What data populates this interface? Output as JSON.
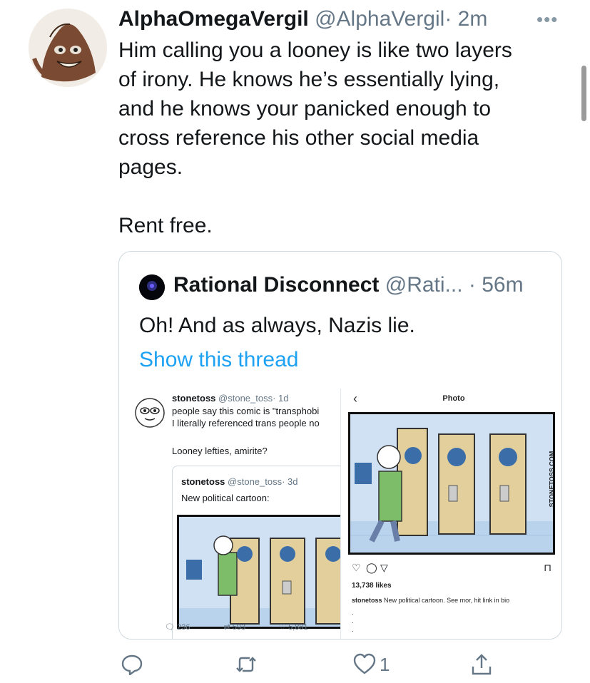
{
  "tweet": {
    "display_name": "AlphaOmegaVergil",
    "handle": "@AlphaVergil",
    "time": "· 2m",
    "more_icon": "more-icon",
    "text_lines": [
      "Him calling you a looney is like two layers",
      "of irony. He knows he’s essentially lying,",
      "and he knows your panicked enough to",
      "cross reference his other social media",
      "pages."
    ],
    "text_extra": "Rent free."
  },
  "quote": {
    "display_name": "Rational Disconnect",
    "handle": "@Rati...",
    "time": "· 56m",
    "text": "Oh! And as always, Nazis lie.",
    "thread_link": "Show this thread",
    "left_image": {
      "name": "stonetoss",
      "handle": "@stone_toss",
      "time": "· 1d",
      "line1": "people say this comic is \"transphobi",
      "line2": "I literally referenced trans people no",
      "line3": "Looney lefties, amirite?",
      "inner": {
        "name": "stonetoss",
        "handle": "@stone_toss",
        "time": "· 3d",
        "text": "New political cartoon:"
      },
      "replies": "236",
      "retweets": "593",
      "likes": "5,881"
    },
    "right_image": {
      "title": "Photo",
      "likes": "13,738 likes",
      "caption_user": "stonetoss",
      "caption_text": "New political cartoon. See mor, hit link in bio",
      "watermark": "STONETOSS.COM"
    }
  },
  "actions": {
    "reply_icon": "reply-icon",
    "retweet_icon": "retweet-icon",
    "like_icon": "heart-icon",
    "like_count": "1",
    "share_icon": "share-icon"
  },
  "colors": {
    "link": "#1da1f2",
    "secondary_text": "#657786",
    "border": "#cfd9de"
  }
}
